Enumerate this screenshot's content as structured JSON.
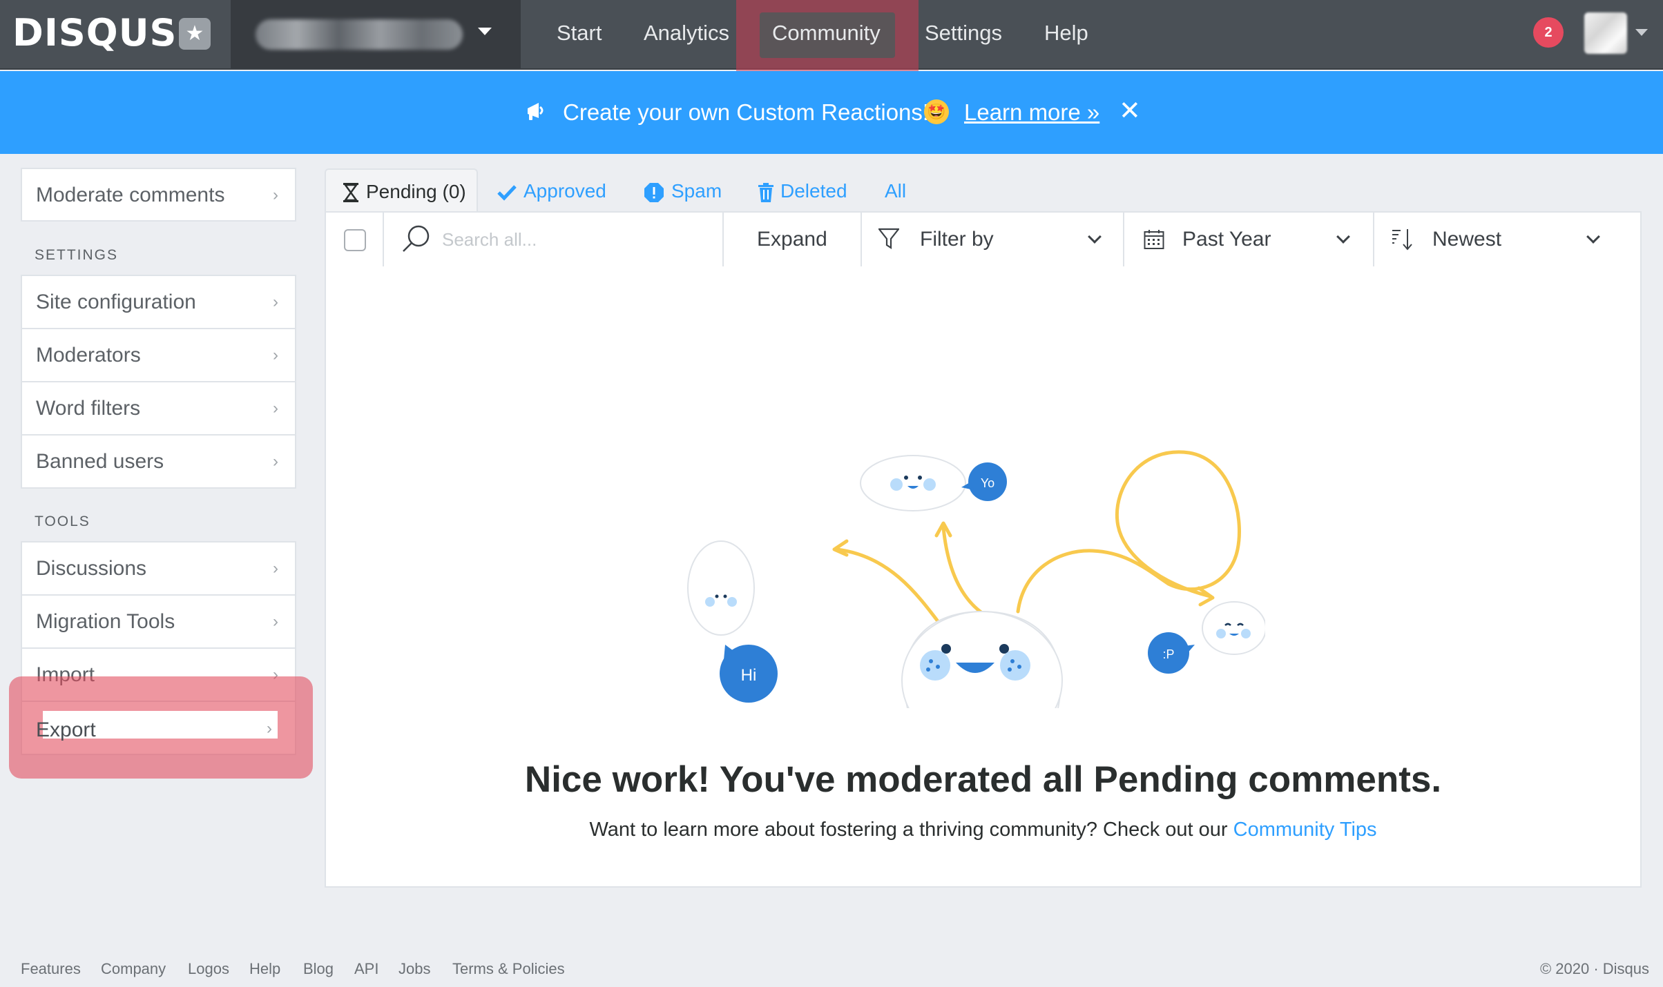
{
  "nav": {
    "brand": "DISQUS",
    "items": [
      {
        "label": "Start"
      },
      {
        "label": "Analytics"
      },
      {
        "label": "Community"
      },
      {
        "label": "Settings"
      },
      {
        "label": "Help"
      }
    ],
    "active": "Community",
    "notification_count": "2"
  },
  "banner": {
    "text": "Create your own Custom Reactions!",
    "link": "Learn more »",
    "close": "✕",
    "emoji": "🤩"
  },
  "sidebar": {
    "top_item": "Moderate comments",
    "settings_heading": "SETTINGS",
    "settings_items": [
      {
        "label": "Site configuration"
      },
      {
        "label": "Moderators"
      },
      {
        "label": "Word filters"
      },
      {
        "label": "Banned users"
      }
    ],
    "tools_heading": "TOOLS",
    "tools_items": [
      {
        "label": "Discussions"
      },
      {
        "label": "Migration Tools"
      },
      {
        "label": "Import"
      },
      {
        "label": "Export"
      }
    ]
  },
  "tabs": {
    "pending": "Pending (0)",
    "approved": "Approved",
    "spam": "Spam",
    "deleted": "Deleted",
    "all": "All"
  },
  "toolbar": {
    "search_placeholder": "Search all...",
    "expand": "Expand",
    "filter": "Filter by",
    "date_range": "Past Year",
    "sort": "Newest"
  },
  "illustration": {
    "bubble_yo": "Yo",
    "bubble_hi": "Hi",
    "bubble_p": ":P"
  },
  "empty_state": {
    "title": "Nice work! You've moderated all Pending comments.",
    "subtitle": "Want to learn more about fostering a thriving community? Check out our",
    "link": "Community Tips"
  },
  "footer": {
    "links": [
      "Features",
      "Company",
      "Logos",
      "Help",
      "Blog",
      "API",
      "Jobs",
      "Terms & Policies"
    ],
    "copyright": "© 2020 · Disqus"
  },
  "colors": {
    "nav_bg": "#4a5056",
    "banner_bg": "#2e9fff",
    "accent": "#2e9fff",
    "highlight": "#e14a5c",
    "illustration_yellow": "#f8c94e"
  }
}
